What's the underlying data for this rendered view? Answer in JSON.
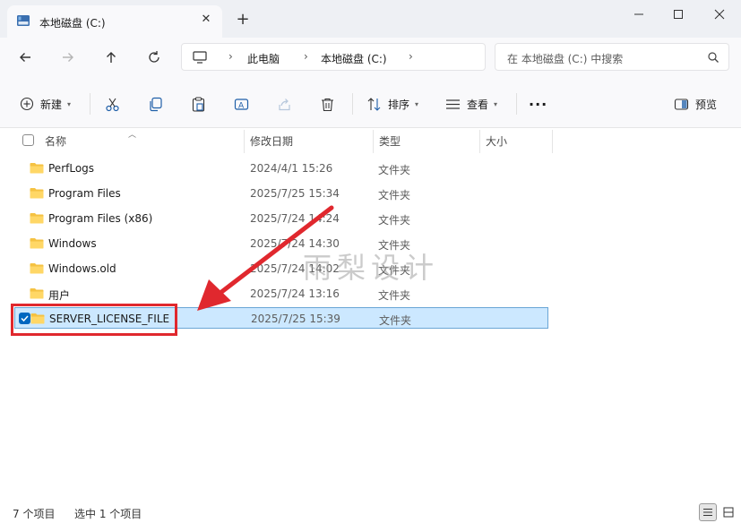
{
  "window": {
    "tab_title": "本地磁盘 (C:)",
    "new_tab": "+",
    "close_tab": "✕"
  },
  "address": {
    "crumbs": [
      "此电脑",
      "本地磁盘 (C:)"
    ],
    "search_placeholder": "在 本地磁盘 (C:) 中搜索"
  },
  "toolbar": {
    "new_label": "新建",
    "sort_label": "排序",
    "view_label": "查看",
    "more_label": "···",
    "preview_label": "预览"
  },
  "columns": {
    "name": "名称",
    "modified": "修改日期",
    "type": "类型",
    "size": "大小"
  },
  "rows": [
    {
      "name": "PerfLogs",
      "date": "2024/4/1 15:26",
      "type": "文件夹"
    },
    {
      "name": "Program Files",
      "date": "2025/7/25 15:34",
      "type": "文件夹"
    },
    {
      "name": "Program Files (x86)",
      "date": "2025/7/24 14:24",
      "type": "文件夹"
    },
    {
      "name": "Windows",
      "date": "2025/7/24 14:30",
      "type": "文件夹"
    },
    {
      "name": "Windows.old",
      "date": "2025/7/24 14:02",
      "type": "文件夹"
    },
    {
      "name": "用户",
      "date": "2025/7/24 13:16",
      "type": "文件夹"
    },
    {
      "name": "SERVER_LICENSE_FILE",
      "date": "2025/7/25 15:39",
      "type": "文件夹",
      "selected": true
    }
  ],
  "watermark": "雨梨设计",
  "status": {
    "item_count": "7 个项目",
    "selected_count": "选中 1 个项目"
  },
  "colors": {
    "accent": "#0067c0",
    "selection": "#cce8ff",
    "annotation": "#e0282e",
    "folder": "#f5c242"
  },
  "icons": [
    "drive-icon",
    "back-icon",
    "forward-icon",
    "up-icon",
    "refresh-icon",
    "computer-icon",
    "search-icon",
    "new-icon",
    "cut-icon",
    "copy-icon",
    "paste-icon",
    "rename-icon",
    "share-icon",
    "delete-icon",
    "sort-icon",
    "view-icon",
    "preview-icon",
    "folder-icon",
    "details-view-icon",
    "tiles-view-icon"
  ]
}
